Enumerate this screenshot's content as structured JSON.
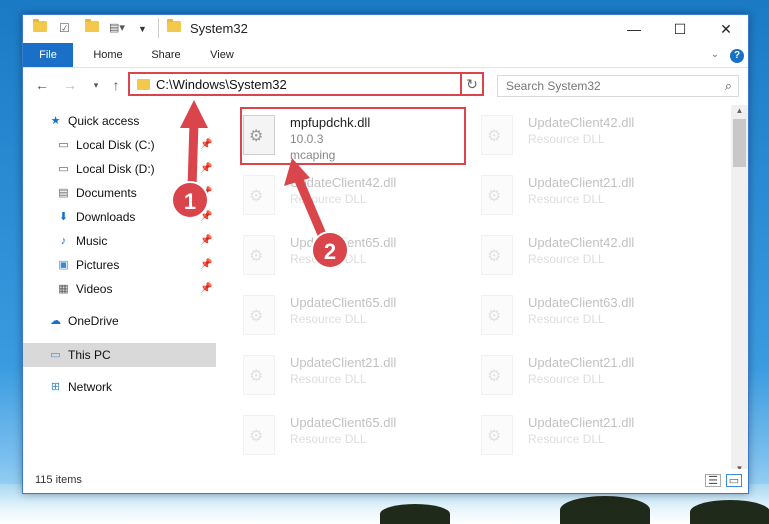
{
  "window": {
    "title": "System32"
  },
  "ribbon": {
    "tabs": [
      "File",
      "Home",
      "Share",
      "View"
    ]
  },
  "address": {
    "path": "C:\\Windows\\System32"
  },
  "search": {
    "placeholder": "Search System32"
  },
  "sidebar": {
    "items": [
      {
        "label": "Quick access",
        "icon": "star-icon"
      },
      {
        "label": "Local Disk (C:)",
        "icon": "drive-icon",
        "pinned": true
      },
      {
        "label": "Local Disk (D:)",
        "icon": "drive-icon",
        "pinned": true
      },
      {
        "label": "Documents",
        "icon": "documents-icon",
        "pinned": true
      },
      {
        "label": "Downloads",
        "icon": "download-icon",
        "pinned": true
      },
      {
        "label": "Music",
        "icon": "music-icon",
        "pinned": true
      },
      {
        "label": "Pictures",
        "icon": "pictures-icon",
        "pinned": true
      },
      {
        "label": "Videos",
        "icon": "video-icon",
        "pinned": true
      },
      {
        "label": "OneDrive",
        "icon": "cloud-icon"
      },
      {
        "label": "This PC",
        "icon": "computer-icon",
        "selected": true
      },
      {
        "label": "Network",
        "icon": "network-icon"
      }
    ]
  },
  "files": {
    "selected": {
      "name": "mpfupdchk.dll",
      "version": "10.0.3",
      "company": "mcaping"
    },
    "faded": [
      {
        "name": "UpdateClient42.dll",
        "desc": "Resource DLL"
      },
      {
        "name": "UpdateClient42.dll",
        "desc": "Resource DLL"
      },
      {
        "name": "UpdateClient21.dll",
        "desc": "Resource DLL"
      },
      {
        "name": "UpdateClient65.dll",
        "desc": "Resource DLL"
      },
      {
        "name": "UpdateClient42.dll",
        "desc": "Resource DLL"
      },
      {
        "name": "UpdateClient65.dll",
        "desc": "Resource DLL"
      },
      {
        "name": "UpdateClient63.dll",
        "desc": "Resource DLL"
      },
      {
        "name": "UpdateClient21.dll",
        "desc": "Resource DLL"
      },
      {
        "name": "UpdateClient21.dll",
        "desc": "Resource DLL"
      },
      {
        "name": "UpdateClient65.dll",
        "desc": "Resource DLL"
      },
      {
        "name": "UpdateClient21.dll",
        "desc": "Resource DLL"
      }
    ]
  },
  "status": {
    "count": "115 items"
  },
  "annotations": {
    "step1": "1",
    "step2": "2"
  },
  "colors": {
    "accent": "#1a6fc7",
    "highlight": "#d9454a"
  }
}
